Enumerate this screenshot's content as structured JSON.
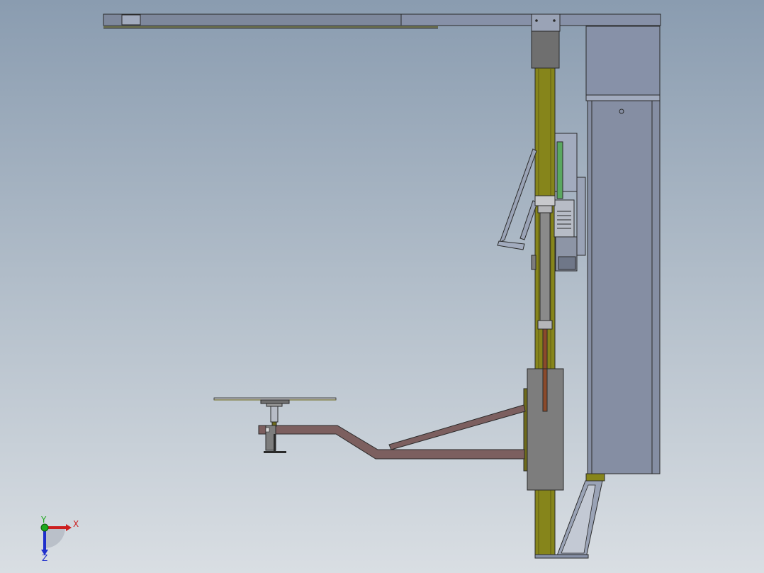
{
  "viewport": {
    "background_top": "#8a9cb0",
    "background_bottom": "#d9dee3"
  },
  "colors": {
    "steel": "#8791a8",
    "steel_light": "#a2abbe",
    "steel_dark": "#6f7788",
    "outline": "#2a2a2a",
    "column_olive": "#86851b",
    "arm_brown": "#7c5f5f",
    "rod_brown": "#8b4a2b",
    "carriage_gray": "#7d7d7d",
    "motor_green": "#5aa860",
    "plate_olive": "#6e6b1c",
    "axis_x": "#cc1f1f",
    "axis_y": "#1ea81e",
    "axis_z": "#1f2fcc"
  },
  "triad": {
    "x_label": "X",
    "y_label": "Y",
    "z_label": "Z"
  }
}
